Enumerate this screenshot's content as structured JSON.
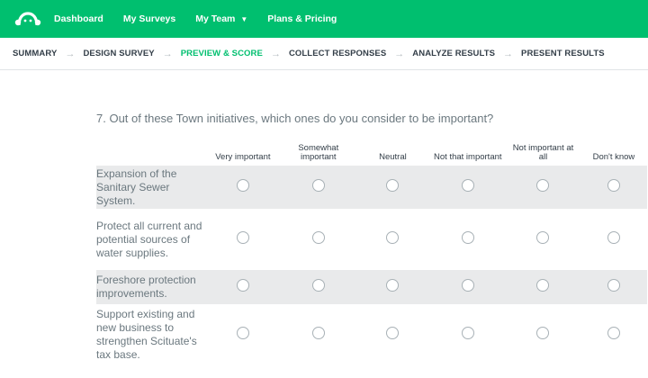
{
  "topnav": {
    "logo": "surveymonkey-logo-icon",
    "items": [
      {
        "label": "Dashboard"
      },
      {
        "label": "My Surveys"
      },
      {
        "label": "My Team",
        "has_caret": true
      },
      {
        "label": "Plans & Pricing"
      }
    ]
  },
  "steps": [
    {
      "label": "SUMMARY",
      "active": false
    },
    {
      "label": "DESIGN SURVEY",
      "active": false
    },
    {
      "label": "PREVIEW & SCORE",
      "active": true
    },
    {
      "label": "COLLECT RESPONSES",
      "active": false
    },
    {
      "label": "ANALYZE RESULTS",
      "active": false
    },
    {
      "label": "PRESENT RESULTS",
      "active": false
    }
  ],
  "question": {
    "text": "7. Out of these Town initiatives, which ones do you consider to be important?",
    "columns": [
      "Very important",
      "Somewhat important",
      "Neutral",
      "Not that important",
      "Not important at all",
      "Don't know"
    ],
    "rows": [
      {
        "label": "Expansion of the Sanitary Sewer System.",
        "shaded": true
      },
      {
        "label": "Protect all current and potential sources of water supplies.",
        "shaded": false
      },
      {
        "label": "Foreshore protection improvements.",
        "shaded": true
      },
      {
        "label": "Support existing and new business to strengthen Scituate's tax base.",
        "shaded": false
      }
    ]
  },
  "colors": {
    "brand": "#00bf6f",
    "shaded_row": "#e9eaeb",
    "text": "#333e48"
  }
}
